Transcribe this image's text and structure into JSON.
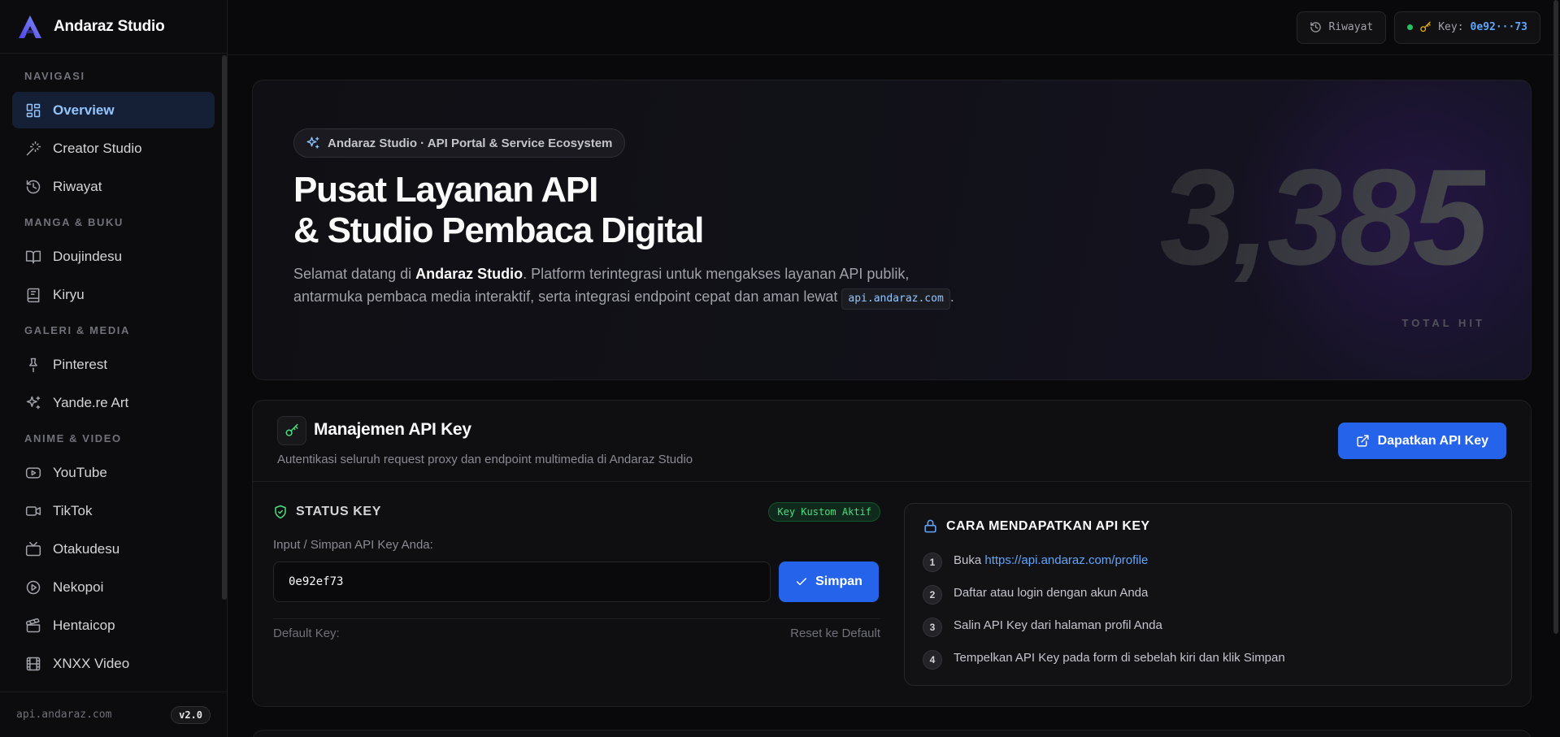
{
  "brand": {
    "name": "Andaraz Studio",
    "accent": "#6366f1"
  },
  "sidebar": {
    "sections": [
      {
        "title": "NAVIGASI",
        "items": [
          {
            "label": "Overview",
            "icon": "grid-icon",
            "active": true
          },
          {
            "label": "Creator Studio",
            "icon": "magic-wand-icon"
          },
          {
            "label": "Riwayat",
            "icon": "history-icon"
          }
        ]
      },
      {
        "title": "MANGA & BUKU",
        "items": [
          {
            "label": "Doujindesu",
            "icon": "book-open-icon"
          },
          {
            "label": "Kiryu",
            "icon": "book-icon"
          }
        ]
      },
      {
        "title": "GALERI & MEDIA",
        "items": [
          {
            "label": "Pinterest",
            "icon": "pin-icon"
          },
          {
            "label": "Yande.re Art",
            "icon": "sparkles-icon"
          }
        ]
      },
      {
        "title": "ANIME & VIDEO",
        "items": [
          {
            "label": "YouTube",
            "icon": "youtube-icon"
          },
          {
            "label": "TikTok",
            "icon": "video-icon"
          },
          {
            "label": "Otakudesu",
            "icon": "tv-icon"
          },
          {
            "label": "Nekopoi",
            "icon": "play-circle-icon"
          },
          {
            "label": "Hentaicop",
            "icon": "clapperboard-icon"
          },
          {
            "label": "XNXX Video",
            "icon": "film-icon"
          }
        ]
      }
    ],
    "footer": {
      "domain": "api.andaraz.com",
      "version": "v2.0"
    }
  },
  "topbar": {
    "history_label": "Riwayat",
    "key_prefix": "Key:",
    "key_masked": "0e92···73"
  },
  "hero": {
    "badge": "Andaraz Studio · API Portal & Service Ecosystem",
    "title_line1": "Pusat Layanan API",
    "title_line2": "& Studio Pembaca Digital",
    "desc_pre": "Selamat datang di ",
    "desc_brand": "Andaraz Studio",
    "desc_post": ". Platform terintegrasi untuk mengakses layanan API publik, antarmuka pembaca media interaktif, serta integrasi endpoint cepat dan aman lewat ",
    "desc_code": "api.andaraz.com",
    "desc_end": ".",
    "total_hits": "3,385",
    "total_hits_label": "TOTAL HIT"
  },
  "api_panel": {
    "title": "Manajemen API Key",
    "subtitle": "Autentikasi seluruh request proxy dan endpoint multimedia di Andaraz Studio",
    "get_key_button": "Dapatkan API Key",
    "status_label": "STATUS KEY",
    "status_badge": "Key Kustom Aktif",
    "input_label": "Input / Simpan API Key Anda:",
    "input_value": "0e92ef73",
    "save_button": "Simpan",
    "default_key_label": "Default Key:",
    "reset_label": "Reset ke Default",
    "howto": {
      "title": "CARA MENDAPATKAN API KEY",
      "steps": [
        {
          "num": "1",
          "text": "Buka ",
          "link": "https://api.andaraz.com/profile"
        },
        {
          "num": "2",
          "text": "Daftar atau login dengan akun Anda"
        },
        {
          "num": "3",
          "text": "Salin API Key dari halaman profil Anda"
        },
        {
          "num": "4",
          "text": "Tempelkan API Key pada form di sebelah kiri dan klik Simpan"
        }
      ]
    }
  }
}
